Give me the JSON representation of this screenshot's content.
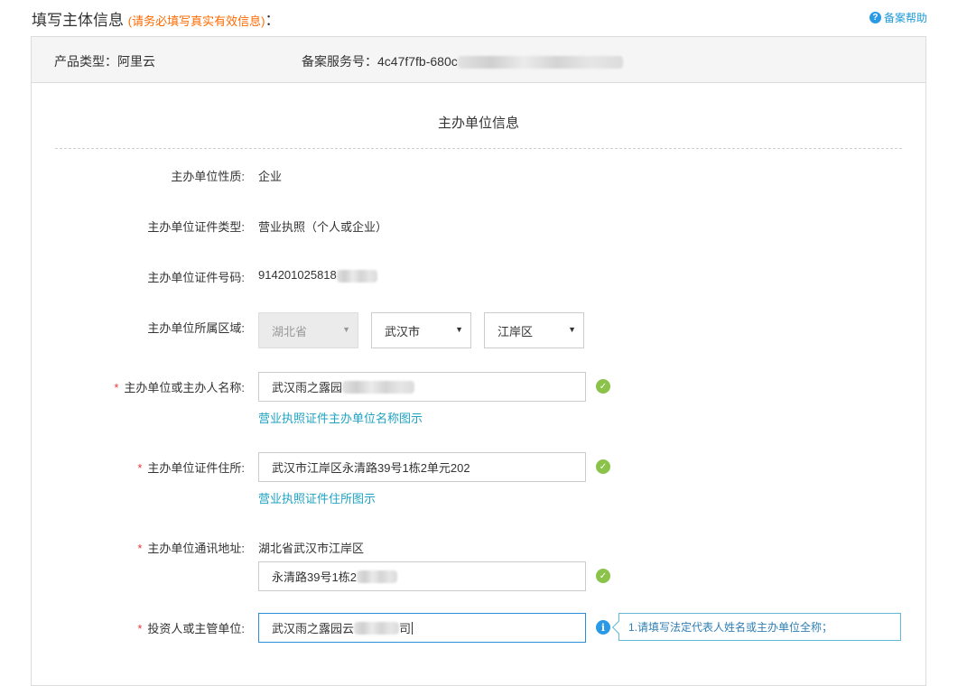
{
  "header": {
    "title": "填写主体信息",
    "note": "(请务必填写真实有效信息)",
    "colon": "：",
    "help_label": "备案帮助",
    "help_icon_glyph": "?"
  },
  "panel_head": {
    "product_type_label": "产品类型：",
    "product_type_value": "阿里云",
    "service_no_label": "备案服务号：",
    "service_no_value": "4c47f7fb-680c"
  },
  "section": {
    "title": "主办单位信息"
  },
  "fields": {
    "nature": {
      "label": "主办单位性质:",
      "value": "企业"
    },
    "cert_type": {
      "label": "主办单位证件类型:",
      "value": "营业执照（个人或企业）"
    },
    "cert_no": {
      "label": "主办单位证件号码:",
      "value": "914201025818"
    },
    "region": {
      "label": "主办单位所属区域:",
      "province": "湖北省",
      "city": "武汉市",
      "district": "江岸区",
      "arrow_glyph": "▼"
    },
    "name": {
      "required_mark": "*",
      "label": "主办单位或主办人名称:",
      "value": "武汉雨之露园",
      "link": "营业执照证件主办单位名称图示"
    },
    "address": {
      "required_mark": "*",
      "label": "主办单位证件住所:",
      "value": "武汉市江岸区永清路39号1栋2单元202",
      "link": "营业执照证件住所图示"
    },
    "mailing": {
      "required_mark": "*",
      "label": "主办单位通讯地址:",
      "prefix": "湖北省武汉市江岸区",
      "value": "永清路39号1栋2"
    },
    "investor": {
      "required_mark": "*",
      "label": "投资人或主管单位:",
      "value_start": "武汉雨之露园云",
      "value_end": "司",
      "tip": "1.请填写法定代表人姓名或主办单位全称；",
      "info_glyph": "i"
    }
  },
  "icons": {
    "check_glyph": "✓"
  },
  "colors": {
    "accent": "#ff6a00",
    "link": "#1fa3c2",
    "success": "#8bc34a",
    "info": "#2b9ae6"
  }
}
